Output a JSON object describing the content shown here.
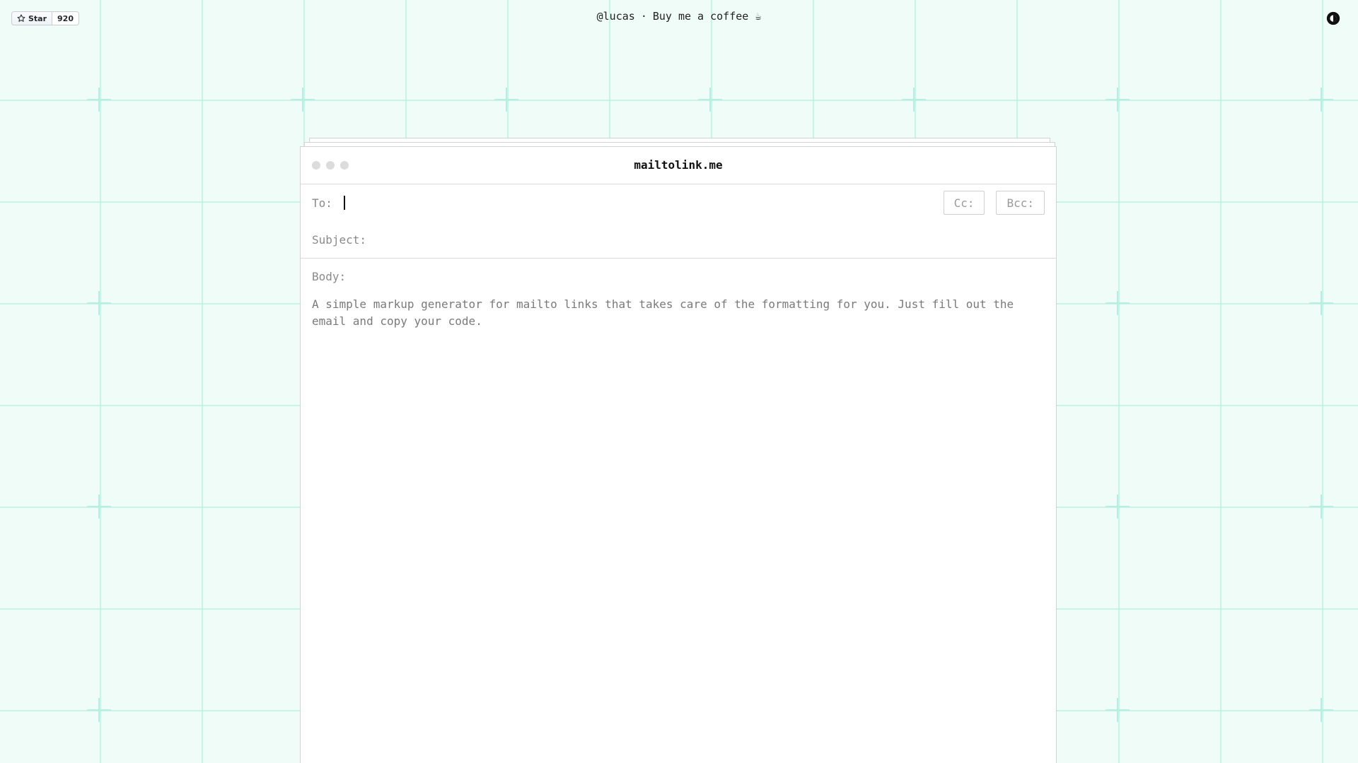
{
  "top_bar": {
    "star_label": "Star",
    "star_count": "920",
    "author_link": "@lucas",
    "separator": "·",
    "coffee_link": "Buy me a coffee ☕",
    "theme_toggle_icon": "contrast-icon"
  },
  "window": {
    "title": "mailtolink.me",
    "to_label": "To:",
    "to_value": "",
    "cc_label": "Cc:",
    "bcc_label": "Bcc:",
    "subject_label": "Subject:",
    "subject_value": "",
    "body_label": "Body:",
    "body_placeholder": "A simple markup generator for mailto links that takes care of the formatting for you. Just fill out the email and copy your code."
  },
  "colors": {
    "background": "#effcf8",
    "grid_line": "#a8eeda",
    "window_border": "#d3d3d3",
    "muted_text": "#8a8a8a"
  }
}
